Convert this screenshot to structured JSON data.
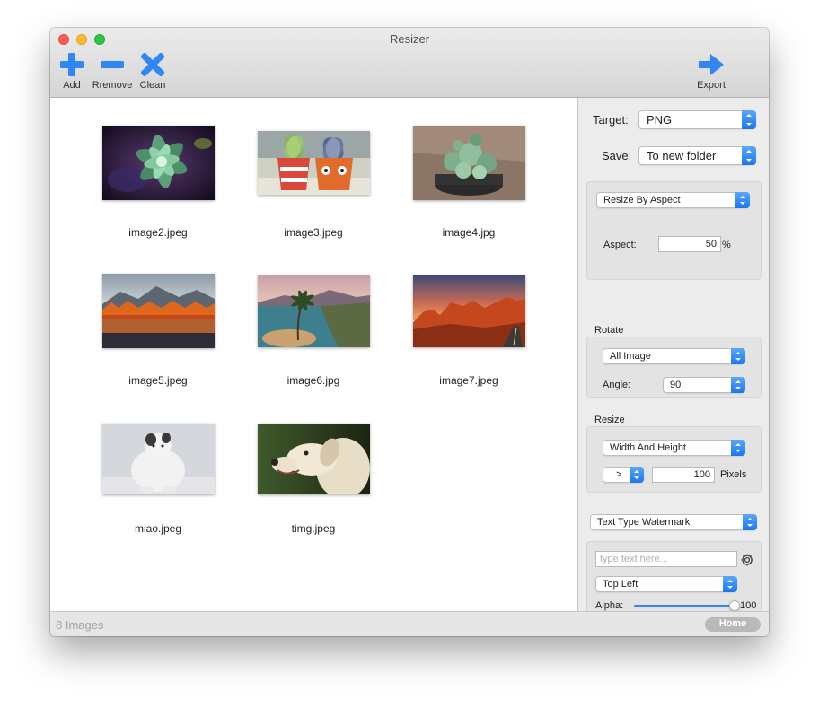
{
  "window": {
    "title": "Resizer"
  },
  "toolbar": {
    "add_label": "Add",
    "remove_label": "Rremove",
    "clean_label": "Clean",
    "export_label": "Export",
    "accent": "#2f86f6"
  },
  "gallery": {
    "images": [
      {
        "name": "image2.jpeg"
      },
      {
        "name": "image3.jpeg"
      },
      {
        "name": "image4.jpg"
      },
      {
        "name": "image5.jpeg"
      },
      {
        "name": "image6.jpg"
      },
      {
        "name": "image7.jpeg"
      },
      {
        "name": "miao.jpeg"
      },
      {
        "name": "timg.jpeg"
      }
    ]
  },
  "sidebar": {
    "target_label": "Target:",
    "target_value": "PNG",
    "save_label": "Save:",
    "save_value": "To new folder",
    "resize_mode": "Resize By Aspect",
    "aspect_label": "Aspect:",
    "aspect_value": "50",
    "aspect_unit": "%",
    "rotate_header": "Rotate",
    "rotate_scope": "All Image",
    "angle_label": "Angle:",
    "angle_value": "90",
    "resize_header": "Resize",
    "resize_dimension": "Width And Height",
    "resize_operator": ">",
    "resize_value": "100",
    "resize_unit": "Pixels",
    "watermark_type": "Text Type Watermark",
    "watermark_placeholder": "type text here...",
    "watermark_position": "Top Left",
    "alpha_label": "Alpha:",
    "alpha_value": "100",
    "alpha_fraction": 1.0
  },
  "status": {
    "count_text": "8 Images",
    "home_label": "Home"
  }
}
